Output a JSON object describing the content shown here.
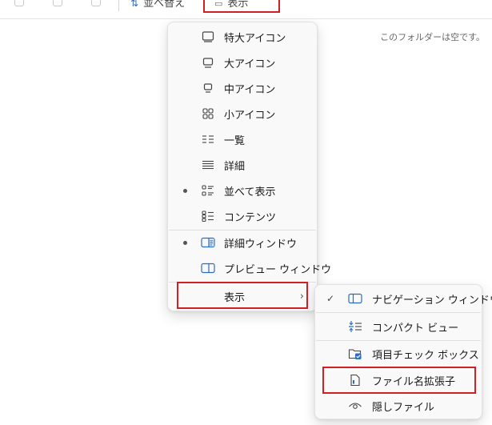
{
  "toolbar": {
    "sort_label": "並べ替え",
    "view_label": "表示"
  },
  "content": {
    "empty_message": "このフォルダーは空です。"
  },
  "view_menu": {
    "items": [
      {
        "label": "特大アイコン",
        "icon": "extra-large-icons-icon",
        "selected": false
      },
      {
        "label": "大アイコン",
        "icon": "large-icons-icon",
        "selected": false
      },
      {
        "label": "中アイコン",
        "icon": "medium-icons-icon",
        "selected": false
      },
      {
        "label": "小アイコン",
        "icon": "small-icons-icon",
        "selected": false
      },
      {
        "label": "一覧",
        "icon": "list-icon",
        "selected": false
      },
      {
        "label": "詳細",
        "icon": "details-icon",
        "selected": false
      },
      {
        "label": "並べて表示",
        "icon": "tiles-icon",
        "selected": true
      },
      {
        "label": "コンテンツ",
        "icon": "content-icon",
        "selected": false
      },
      {
        "label": "詳細ウィンドウ",
        "icon": "details-pane-icon",
        "selected": true
      },
      {
        "label": "プレビュー ウィンドウ",
        "icon": "preview-pane-icon",
        "selected": false
      },
      {
        "label": "表示",
        "icon": "",
        "submenu": true
      }
    ]
  },
  "show_submenu": {
    "items": [
      {
        "label": "ナビゲーション ウィンドウ",
        "icon": "navigation-pane-icon",
        "checked": true
      },
      {
        "label": "コンパクト ビュー",
        "icon": "compact-view-icon",
        "checked": false
      },
      {
        "label": "項目チェック ボックス",
        "icon": "item-checkboxes-icon",
        "checked": false
      },
      {
        "label": "ファイル名拡張子",
        "icon": "file-extensions-icon",
        "checked": false
      },
      {
        "label": "隠しファイル",
        "icon": "hidden-items-icon",
        "checked": false
      }
    ]
  },
  "colors": {
    "highlight_border": "#d21f26",
    "accent_blue": "#2b6cc4",
    "menu_background": "#f9f9f9"
  }
}
